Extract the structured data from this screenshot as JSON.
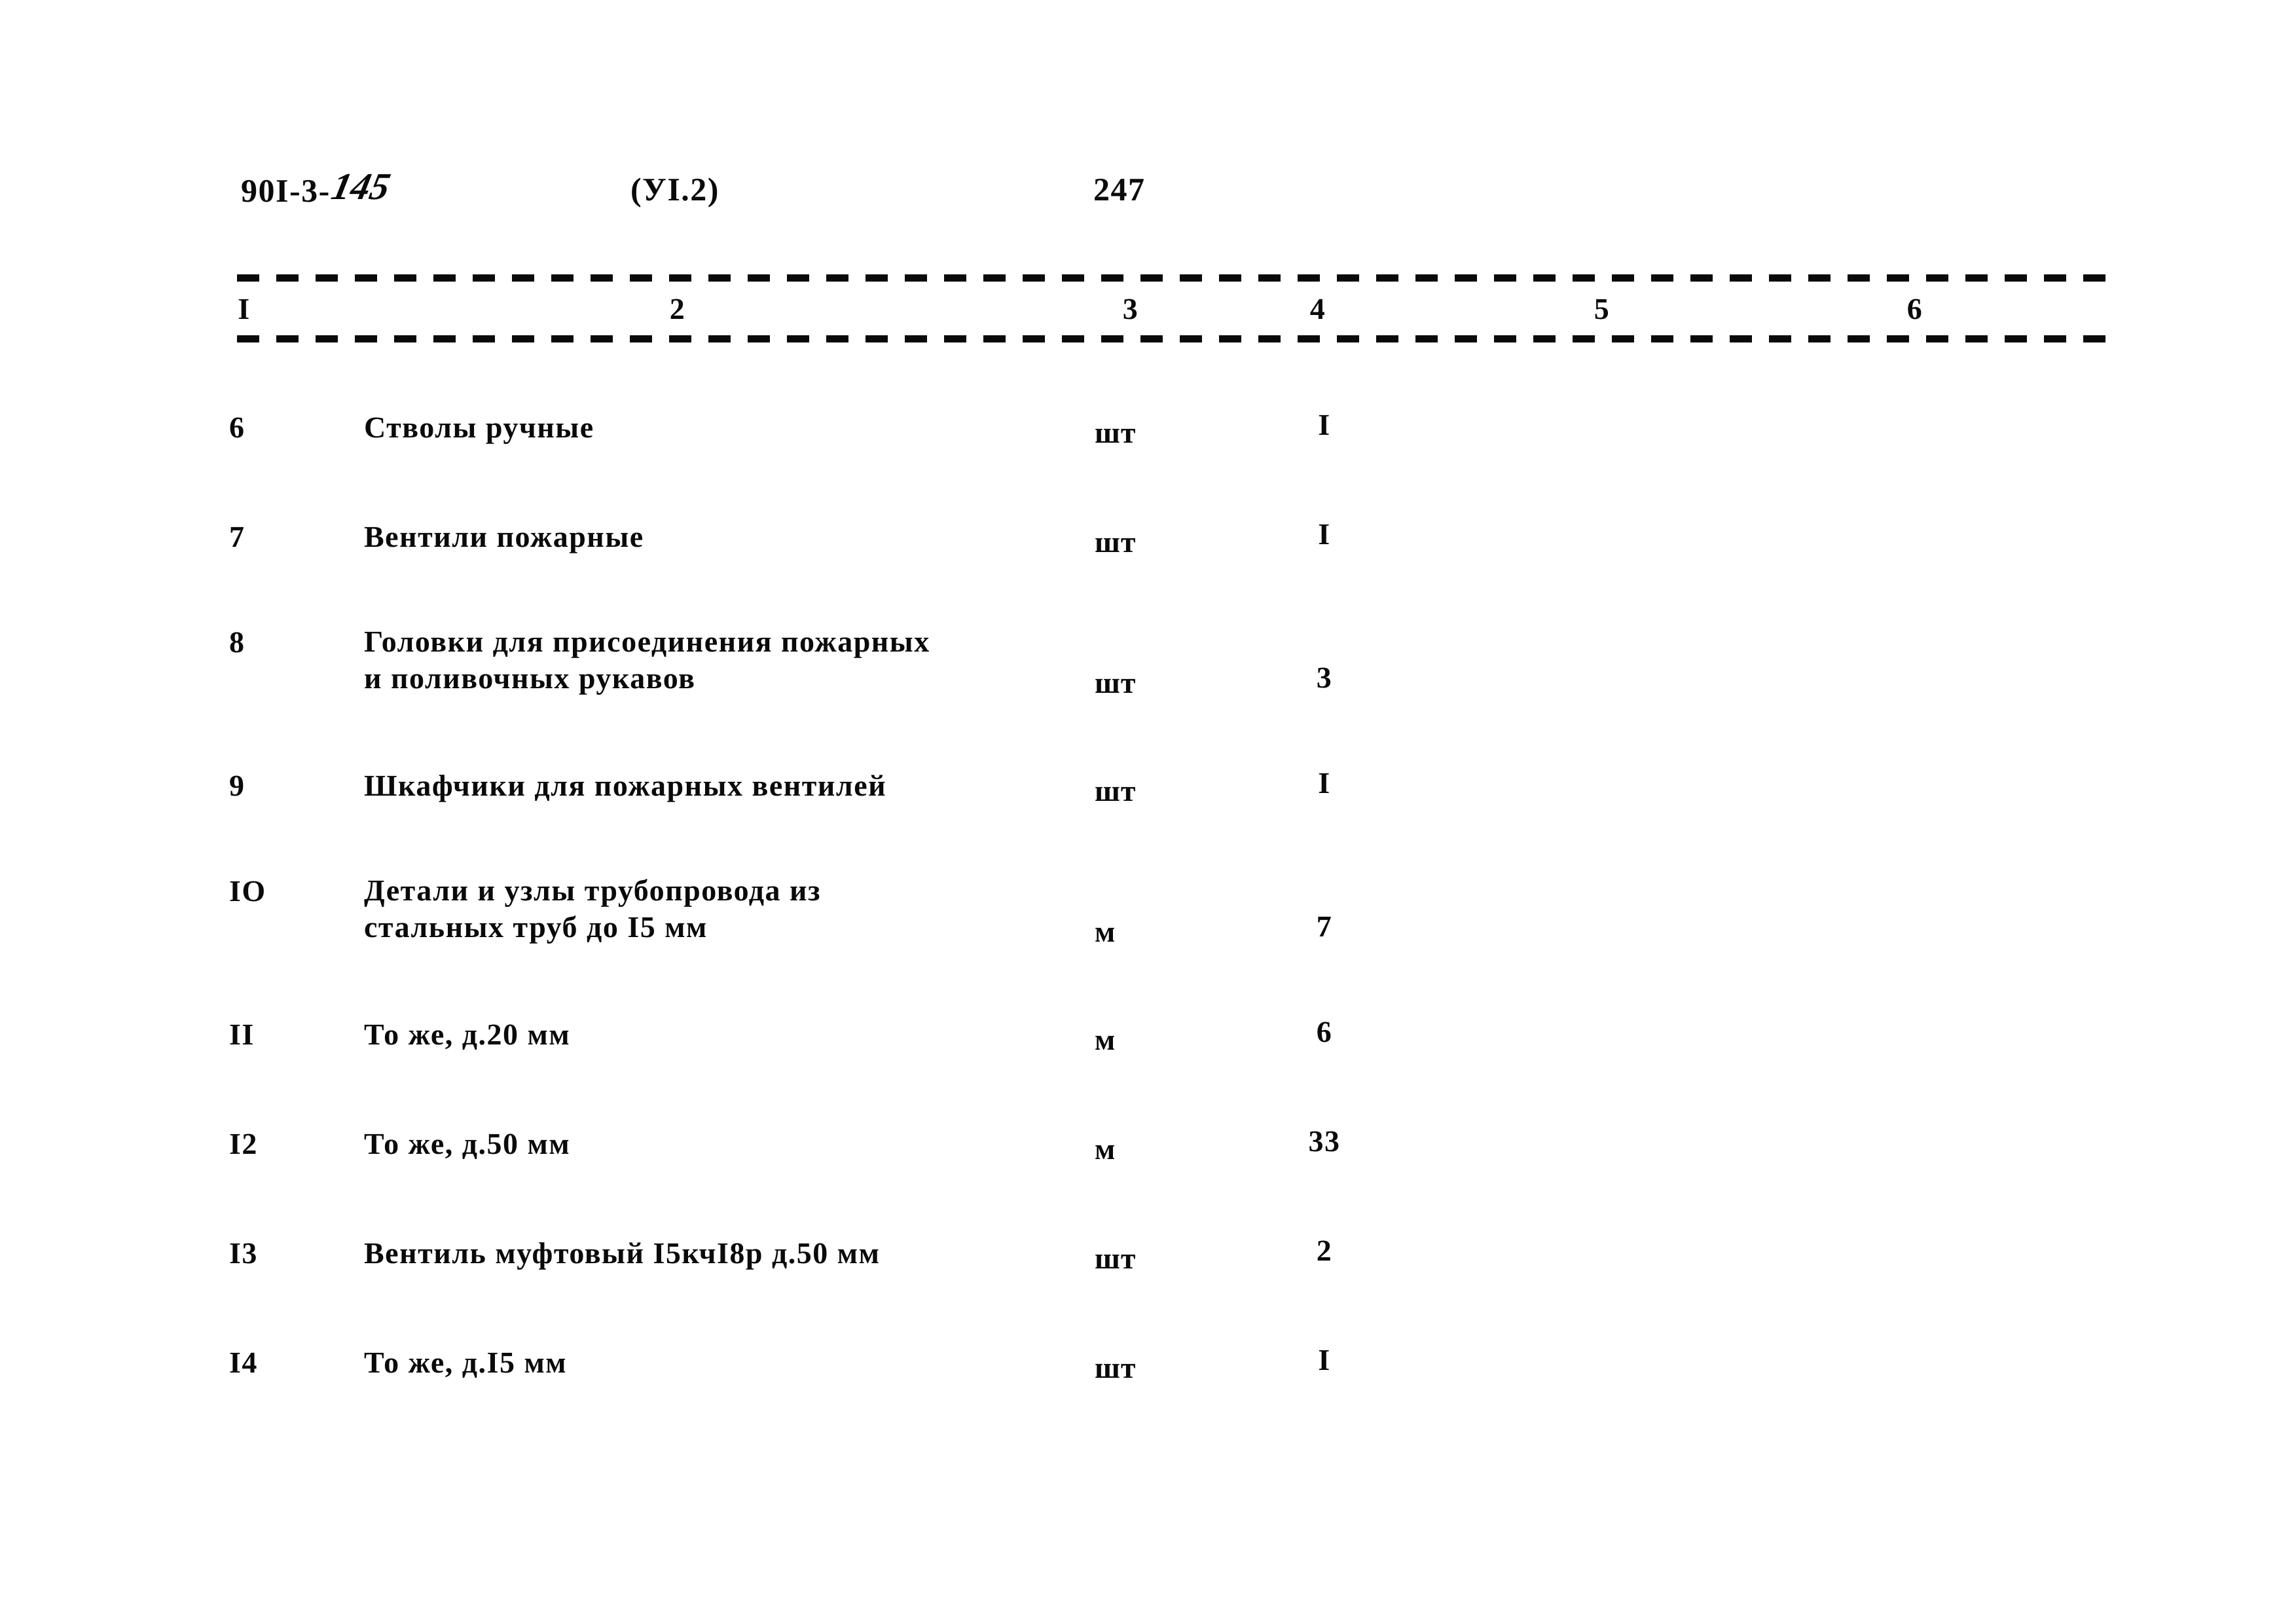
{
  "header": {
    "album_code_printed": "90I-3-",
    "album_code_handwritten": "145",
    "section": "(УI.2)",
    "page_number": "247"
  },
  "table": {
    "column_numbers": [
      "I",
      "2",
      "3",
      "4",
      "5",
      "6"
    ],
    "rows": [
      {
        "num": "6",
        "desc_line1": "Стволы ручные",
        "desc_line2": "",
        "unit": "шт",
        "qty": "I",
        "col5": "",
        "col6": ""
      },
      {
        "num": "7",
        "desc_line1": "Вентили пожарные",
        "desc_line2": "",
        "unit": "шт",
        "qty": "I",
        "col5": "",
        "col6": ""
      },
      {
        "num": "8",
        "desc_line1": "Головки для присоединения пожарных",
        "desc_line2": "и поливочных рукавов",
        "unit": "шт",
        "qty": "3",
        "col5": "",
        "col6": ""
      },
      {
        "num": "9",
        "desc_line1": "Шкафчики для пожарных вентилей",
        "desc_line2": "",
        "unit": "шт",
        "qty": "I",
        "col5": "",
        "col6": ""
      },
      {
        "num": "IO",
        "desc_line1": "Детали и узлы трубопровода из",
        "desc_line2": "стальных труб до I5 мм",
        "unit": "м",
        "qty": "7",
        "col5": "",
        "col6": ""
      },
      {
        "num": "II",
        "desc_line1": "То же, д.20 мм",
        "desc_line2": "",
        "unit": "м",
        "qty": "6",
        "col5": "",
        "col6": ""
      },
      {
        "num": "I2",
        "desc_line1": "То же, д.50 мм",
        "desc_line2": "",
        "unit": "м",
        "qty": "33",
        "col5": "",
        "col6": ""
      },
      {
        "num": "I3",
        "desc_line1": "Вентиль муфтовый I5кчI8р д.50 мм",
        "desc_line2": "",
        "unit": "шт",
        "qty": "2",
        "col5": "",
        "col6": ""
      },
      {
        "num": "I4",
        "desc_line1": "То же, д.I5 мм",
        "desc_line2": "",
        "unit": "шт",
        "qty": "I",
        "col5": "",
        "col6": ""
      }
    ]
  },
  "colors": {
    "ink": "#0a0a0a",
    "paper": "#ffffff"
  }
}
